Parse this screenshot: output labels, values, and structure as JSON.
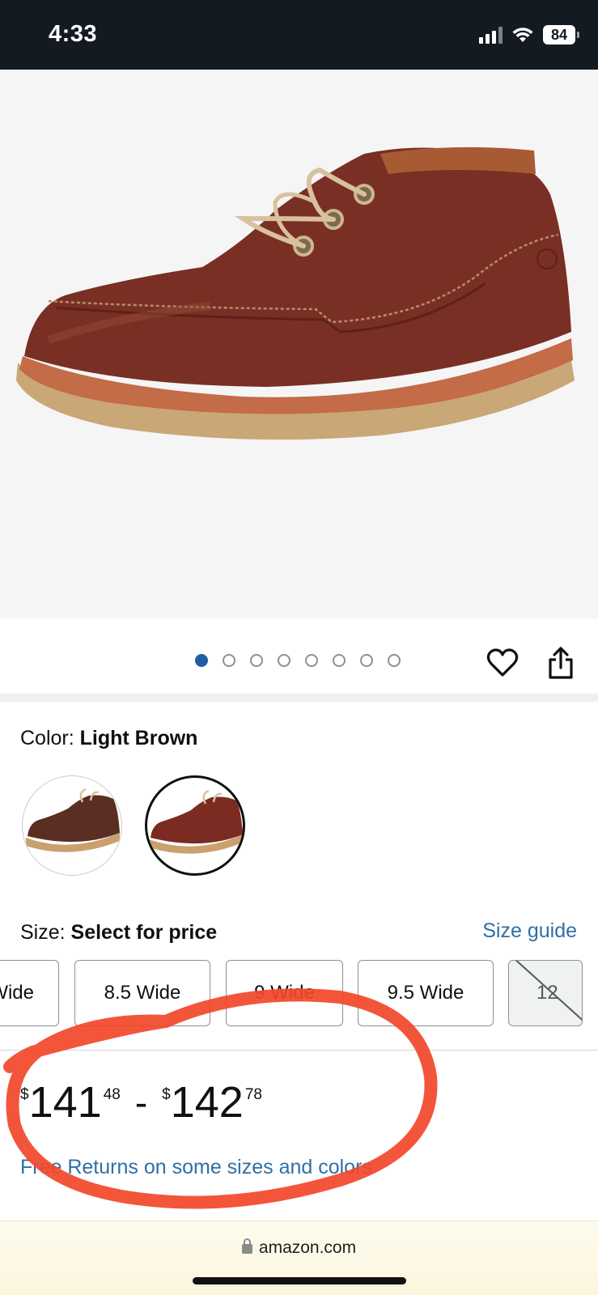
{
  "status_bar": {
    "time": "4:33",
    "battery": "84"
  },
  "gallery": {
    "image_count": 8,
    "active_index": 0
  },
  "actions": {
    "wishlist_icon": "heart-icon",
    "share_icon": "share-icon"
  },
  "color": {
    "label": "Color: ",
    "value": "Light Brown",
    "swatch_colors": [
      "#5a2e22",
      "#7b2b22"
    ],
    "selected_index": 1
  },
  "size": {
    "label": "Size: ",
    "value": "Select for price",
    "guide_link": "Size guide",
    "options": [
      "Wide",
      "8.5 Wide",
      "9 Wide",
      "9.5 Wide",
      "12"
    ],
    "unavailable": [
      "12"
    ]
  },
  "price": {
    "low": {
      "symbol": "$",
      "whole": "141",
      "fraction": "48"
    },
    "separator": "-",
    "high": {
      "symbol": "$",
      "whole": "142",
      "fraction": "78"
    }
  },
  "returns_text": "Free Returns on some sizes and colors",
  "browser": {
    "url": "amazon.com"
  },
  "colors": {
    "link": "#2f6fa5",
    "accent_dot": "#1e5fa8",
    "annotation": "#f2472a",
    "status_bar": "#131a22"
  }
}
